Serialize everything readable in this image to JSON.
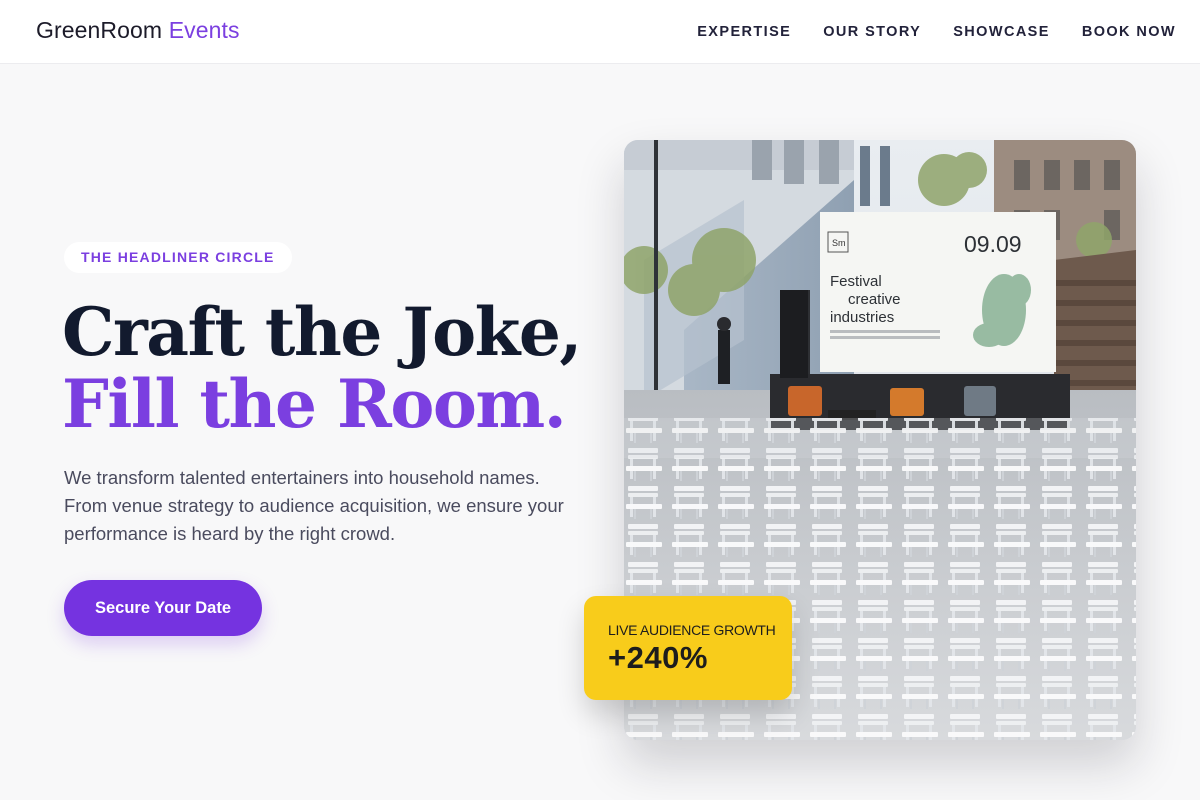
{
  "brand": {
    "name": "GreenRoom",
    "accent_word": "Events",
    "accent_color": "#7b3fe0"
  },
  "nav": {
    "items": [
      {
        "label": "EXPERTISE"
      },
      {
        "label": "OUR STORY"
      },
      {
        "label": "SHOWCASE"
      },
      {
        "label": "BOOK NOW"
      }
    ]
  },
  "hero": {
    "eyebrow": "THE HEADLINER CIRCLE",
    "headline_line1": "Craft the Joke,",
    "headline_line2": "Fill the Room.",
    "description": "We transform talented entertainers into household names. From venue strategy to audience acquisition, we ensure your performance is heard by the right crowd.",
    "cta_label": "Secure Your Date"
  },
  "photo": {
    "screen_date": "09.09",
    "screen_badge": "Sm",
    "screen_title_line1": "Festival",
    "screen_title_line2": "creative",
    "screen_title_line3": "industries"
  },
  "stat": {
    "label": "LIVE AUDIENCE GROWTH",
    "value": "+240%",
    "background": "#f8cc1b"
  },
  "colors": {
    "primary": "#7533e0",
    "headline_dark": "#121a2e",
    "background": "#f8f8f9"
  }
}
